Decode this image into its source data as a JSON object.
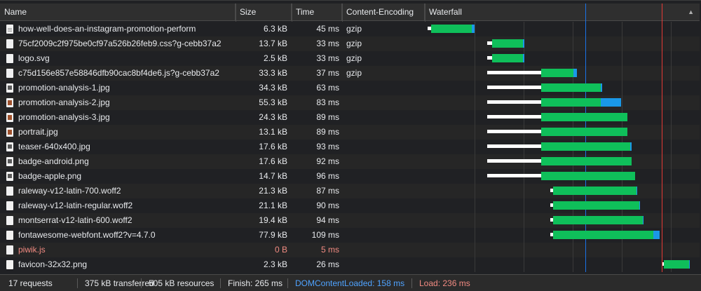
{
  "columns": {
    "name": "Name",
    "size": "Size",
    "time": "Time",
    "encoding": "Content-Encoding",
    "waterfall": "Waterfall"
  },
  "sort_icon": "triangle-up-icon",
  "colors": {
    "waiting": "#ffffff",
    "ttfb": "#0fbf5a",
    "download": "#1a98e8",
    "dom_content_loaded": "#1a73e8",
    "load": "#e53935",
    "error_text": "#f28b82"
  },
  "requests": [
    {
      "name": "how-well-does-an-instagram-promotion-perform",
      "size": "6.3 kB",
      "time": "45 ms",
      "encoding": "gzip",
      "icon": "document-icon"
    },
    {
      "name": "75cf2009c2f975be0cf97a526b26feb9.css?g-cebb37a2",
      "size": "13.7 kB",
      "time": "33 ms",
      "encoding": "gzip",
      "icon": "file-icon"
    },
    {
      "name": "logo.svg",
      "size": "2.5 kB",
      "time": "33 ms",
      "encoding": "gzip",
      "icon": "file-icon"
    },
    {
      "name": "c75d156e857e58846dfb90cac8bf4de6.js?g-cebb37a2",
      "size": "33.3 kB",
      "time": "37 ms",
      "encoding": "gzip",
      "icon": "file-icon"
    },
    {
      "name": "promotion-analysis-1.jpg",
      "size": "34.3 kB",
      "time": "63 ms",
      "encoding": "",
      "icon": "image-icon"
    },
    {
      "name": "promotion-analysis-2.jpg",
      "size": "55.3 kB",
      "time": "83 ms",
      "encoding": "",
      "icon": "photo-icon"
    },
    {
      "name": "promotion-analysis-3.jpg",
      "size": "24.3 kB",
      "time": "89 ms",
      "encoding": "",
      "icon": "photo-icon"
    },
    {
      "name": "portrait.jpg",
      "size": "13.1 kB",
      "time": "89 ms",
      "encoding": "",
      "icon": "photo-icon"
    },
    {
      "name": "teaser-640x400.jpg",
      "size": "17.6 kB",
      "time": "93 ms",
      "encoding": "",
      "icon": "image-icon"
    },
    {
      "name": "badge-android.png",
      "size": "17.6 kB",
      "time": "92 ms",
      "encoding": "",
      "icon": "image-icon"
    },
    {
      "name": "badge-apple.png",
      "size": "14.7 kB",
      "time": "96 ms",
      "encoding": "",
      "icon": "image-icon"
    },
    {
      "name": "raleway-v12-latin-700.woff2",
      "size": "21.3 kB",
      "time": "87 ms",
      "encoding": "",
      "icon": "file-icon"
    },
    {
      "name": "raleway-v12-latin-regular.woff2",
      "size": "21.1 kB",
      "time": "90 ms",
      "encoding": "",
      "icon": "file-icon"
    },
    {
      "name": "montserrat-v12-latin-600.woff2",
      "size": "19.4 kB",
      "time": "94 ms",
      "encoding": "",
      "icon": "file-icon"
    },
    {
      "name": "fontawesome-webfont.woff2?v=4.7.0",
      "size": "77.9 kB",
      "time": "109 ms",
      "encoding": "",
      "icon": "file-icon"
    },
    {
      "name": "piwik.js",
      "size": "0 B",
      "time": "5 ms",
      "encoding": "",
      "icon": "file-icon",
      "error": true
    },
    {
      "name": "favicon-32x32.png",
      "size": "2.3 kB",
      "time": "26 ms",
      "encoding": "",
      "icon": "file-icon"
    }
  ],
  "footer": {
    "requests": "17 requests",
    "transferred": "375 kB transferred",
    "resources": "505 kB resources",
    "finish": "Finish: 265 ms",
    "dom_content_loaded": "DOMContentLoaded: 158 ms",
    "load": "Load: 236 ms"
  }
}
